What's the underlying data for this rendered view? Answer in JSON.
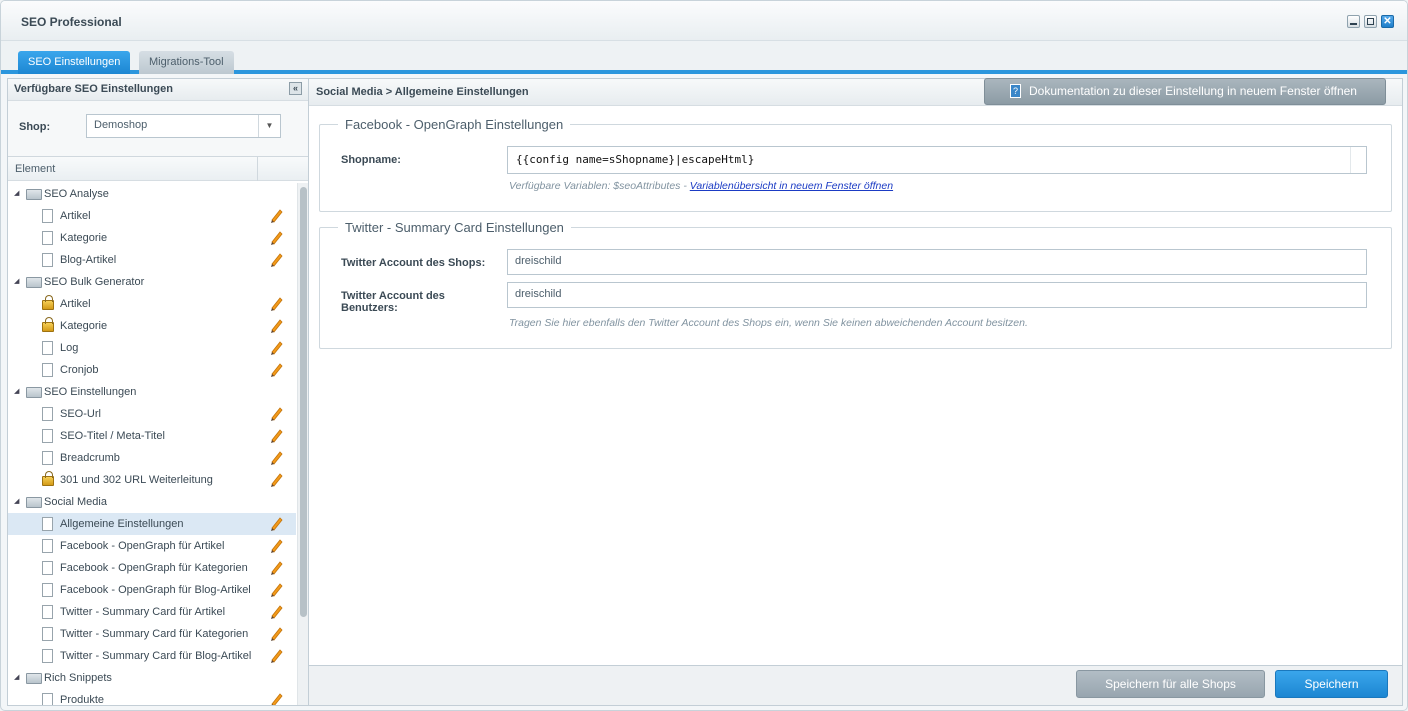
{
  "window": {
    "title": "SEO Professional"
  },
  "tabs": [
    {
      "label": "SEO Einstellungen",
      "active": true
    },
    {
      "label": "Migrations-Tool",
      "active": false
    }
  ],
  "left": {
    "title": "Verfügbare SEO Einstellungen",
    "shop_label": "Shop:",
    "shop_value": "Demoshop",
    "column_header": "Element",
    "tree": [
      {
        "label": "SEO Analyse",
        "level": 0,
        "icon": "folder-icon"
      },
      {
        "label": "Artikel",
        "level": 1,
        "icon": "document-icon"
      },
      {
        "label": "Kategorie",
        "level": 1,
        "icon": "document-icon"
      },
      {
        "label": "Blog-Artikel",
        "level": 1,
        "icon": "document-icon"
      },
      {
        "label": "SEO Bulk Generator",
        "level": 0,
        "icon": "folder-icon"
      },
      {
        "label": "Artikel",
        "level": 1,
        "icon": "lock-icon"
      },
      {
        "label": "Kategorie",
        "level": 1,
        "icon": "lock-icon"
      },
      {
        "label": "Log",
        "level": 1,
        "icon": "document-icon"
      },
      {
        "label": "Cronjob",
        "level": 1,
        "icon": "document-icon"
      },
      {
        "label": "SEO Einstellungen",
        "level": 0,
        "icon": "folder-icon"
      },
      {
        "label": "SEO-Url",
        "level": 1,
        "icon": "document-icon"
      },
      {
        "label": "SEO-Titel / Meta-Titel",
        "level": 1,
        "icon": "document-icon"
      },
      {
        "label": "Breadcrumb",
        "level": 1,
        "icon": "document-icon"
      },
      {
        "label": "301 und 302 URL Weiterleitung",
        "level": 1,
        "icon": "lock-icon"
      },
      {
        "label": "Social Media",
        "level": 0,
        "icon": "folder-icon"
      },
      {
        "label": "Allgemeine Einstellungen",
        "level": 1,
        "icon": "document-icon",
        "selected": true
      },
      {
        "label": "Facebook - OpenGraph für Artikel",
        "level": 1,
        "icon": "document-icon"
      },
      {
        "label": "Facebook - OpenGraph für Kategorien",
        "level": 1,
        "icon": "document-icon"
      },
      {
        "label": "Facebook - OpenGraph für Blog-Artikel",
        "level": 1,
        "icon": "document-icon"
      },
      {
        "label": "Twitter - Summary Card für Artikel",
        "level": 1,
        "icon": "document-icon"
      },
      {
        "label": "Twitter - Summary Card für Kategorien",
        "level": 1,
        "icon": "document-icon"
      },
      {
        "label": "Twitter - Summary Card für Blog-Artikel",
        "level": 1,
        "icon": "document-icon"
      },
      {
        "label": "Rich Snippets",
        "level": 0,
        "icon": "folder-icon"
      },
      {
        "label": "Produkte",
        "level": 1,
        "icon": "document-icon"
      }
    ]
  },
  "right": {
    "breadcrumb": "Social Media > Allgemeine Einstellungen",
    "doc_button": "Dokumentation zu dieser Einstellung in neuem Fenster öffnen",
    "facebook": {
      "legend": "Facebook - OpenGraph Einstellungen",
      "shopname_label": "Shopname:",
      "shopname_value": "{{config name=sShopname}|escapeHtml}",
      "hint_text": "Verfügbare Variablen: $seoAttributes - ",
      "hint_link": "Variablenübersicht in neuem Fenster öffnen"
    },
    "twitter": {
      "legend": "Twitter - Summary Card Einstellungen",
      "shop_account_label": "Twitter Account des Shops:",
      "shop_account_value": "dreischild",
      "user_account_label": "Twitter Account des Benutzers:",
      "user_account_value": "dreischild",
      "hint": "Tragen Sie hier ebenfalls den Twitter Account des Shops ein, wenn Sie keinen abweichenden Account besitzen."
    }
  },
  "footer": {
    "save_all_label": "Speichern für alle Shops",
    "save_label": "Speichern"
  },
  "colors": {
    "accent": "#2b96dd",
    "pencil": "#f39a1a"
  }
}
